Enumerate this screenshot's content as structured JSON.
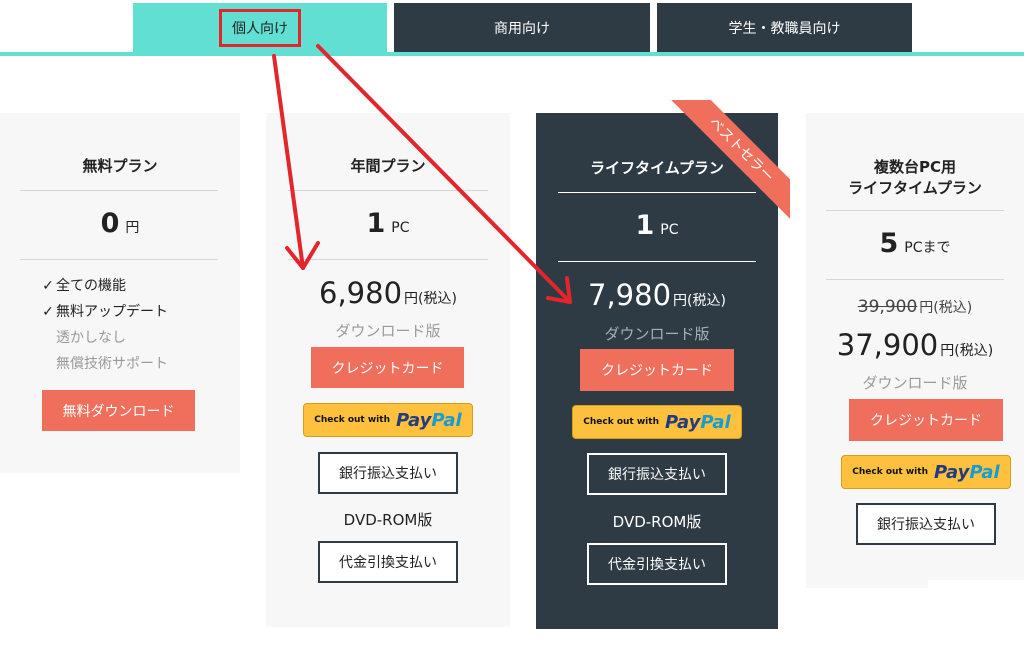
{
  "tabs": {
    "personal": "個人向け",
    "business": "商用向け",
    "education": "学生・教職員向け"
  },
  "plans": {
    "free": {
      "title": "無料プラン",
      "qty": "0",
      "qty_unit": "円",
      "features": [
        {
          "text": "全ての機能",
          "checked": true
        },
        {
          "text": "無料アップデート",
          "checked": true
        },
        {
          "text": "透かしなし",
          "checked": false
        },
        {
          "text": "無償技術サポート",
          "checked": false
        }
      ],
      "download_button": "無料ダウンロード"
    },
    "annual": {
      "title": "年間プラン",
      "qty": "1",
      "qty_unit": "PC",
      "price": "6,980",
      "tax": "円(税込)",
      "download_label": "ダウンロード版",
      "credit_button": "クレジットカード",
      "paypal_small": "Check out with",
      "paypal_pay": "Pay",
      "paypal_pal": "Pal",
      "bank_button": "銀行振込支払い",
      "dvd_label": "DVD-ROM版",
      "cod_button": "代金引換支払い"
    },
    "lifetime": {
      "title": "ライフタイムプラン",
      "ribbon": "ベストセラー",
      "qty": "1",
      "qty_unit": "PC",
      "price": "7,980",
      "tax": "円(税込)",
      "download_label": "ダウンロード版",
      "credit_button": "クレジットカード",
      "paypal_small": "Check out with",
      "paypal_pay": "Pay",
      "paypal_pal": "Pal",
      "bank_button": "銀行振込支払い",
      "dvd_label": "DVD-ROM版",
      "cod_button": "代金引換支払い"
    },
    "multi": {
      "title_line1": "複数台PC用",
      "title_line2": "ライフタイムプラン",
      "qty": "5",
      "qty_unit": "PCまで",
      "old_price": "39,900",
      "old_tax": "円(税込)",
      "price": "37,900",
      "tax": "円(税込)",
      "download_label": "ダウンロード版",
      "credit_button": "クレジットカード",
      "paypal_small": "Check out with",
      "paypal_pay": "Pay",
      "paypal_pal": "Pal",
      "bank_button": "銀行振込支払い"
    }
  },
  "colors": {
    "accent_teal": "#62dfd3",
    "dark": "#2e3a44",
    "button_red": "#f06f5c",
    "paypal_yellow": "#fdc13d",
    "annotation_red": "#e3262b"
  }
}
